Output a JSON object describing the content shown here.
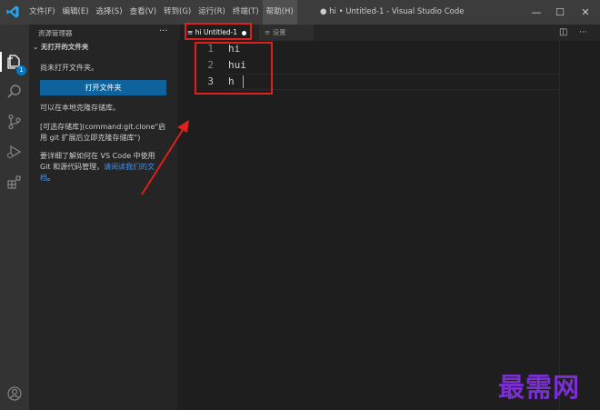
{
  "menu": [
    "文件(F)",
    "编辑(E)",
    "选择(S)",
    "查看(V)",
    "转到(G)",
    "运行(R)",
    "终端(T)",
    "帮助(H)"
  ],
  "window_title": "● hi • Untitled-1 - Visual Studio Code",
  "window_controls": {
    "minimize": "—",
    "maximize": "☐",
    "close": "✕"
  },
  "activity_badge": "1",
  "sidebar": {
    "header": "资源管理器",
    "more": "···",
    "section": "无打开的文件夹",
    "no_folder_text": "尚未打开文件夹。",
    "open_folder_button": "打开文件夹",
    "clone_text": "可以在本地克隆存储库。",
    "clone_hint": "[可选存储库](command:git.clone\"启用 git 扩展后立即克隆存储库\")",
    "learn_more_prefix": "要详细了解如何在 VS Code 中使用 Git 和源代码管理，",
    "learn_more_link": "请阅读我们的文档",
    "learn_more_suffix": "。"
  },
  "tabs": [
    {
      "icon": "≡",
      "label": "hi Untitled-1"
    },
    {
      "icon": "≡",
      "label": "设置"
    }
  ],
  "editor_actions": {
    "split": "◫",
    "more": "···"
  },
  "editor": {
    "lines": [
      {
        "number": "1",
        "text": "hi"
      },
      {
        "number": "2",
        "text": "hui"
      },
      {
        "number": "3",
        "text": "h"
      }
    ]
  },
  "watermark": "最需网",
  "colors": {
    "accent": "#007acc",
    "annotation": "#e0201c",
    "watermark": "#7b2fd1"
  }
}
